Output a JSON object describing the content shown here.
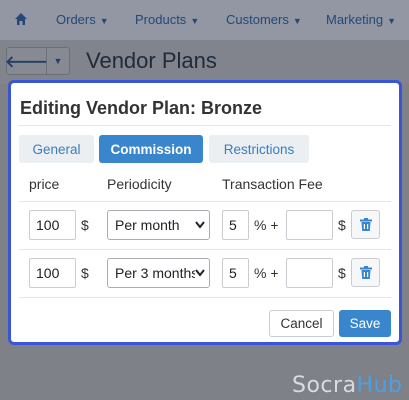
{
  "nav": {
    "items": [
      "Orders",
      "Products",
      "Customers",
      "Marketing"
    ]
  },
  "page": {
    "title": "Vendor Plans"
  },
  "modal": {
    "title": "Editing Vendor Plan: Bronze",
    "tabs": [
      {
        "label": "General",
        "active": false
      },
      {
        "label": "Commission",
        "active": true
      },
      {
        "label": "Restrictions",
        "active": false
      }
    ],
    "columns": {
      "price": "price",
      "periodicity": "Periodicity",
      "fee": "Transaction Fee"
    },
    "rows": [
      {
        "price": "100",
        "currency": "$",
        "periodicity": "Per month",
        "fee_percent": "5",
        "percent_sign": "% +",
        "fee_fixed": "",
        "fee_currency": "$"
      },
      {
        "price": "100",
        "currency": "$",
        "periodicity": "Per 3 months",
        "fee_percent": "5",
        "percent_sign": "% +",
        "fee_fixed": "",
        "fee_currency": "$"
      }
    ],
    "buttons": {
      "cancel": "Cancel",
      "save": "Save"
    }
  },
  "watermark": {
    "part1": "Socra",
    "part2": "Hub"
  },
  "colors": {
    "accent": "#3a86cc",
    "modal_border": "#3a55d6"
  }
}
